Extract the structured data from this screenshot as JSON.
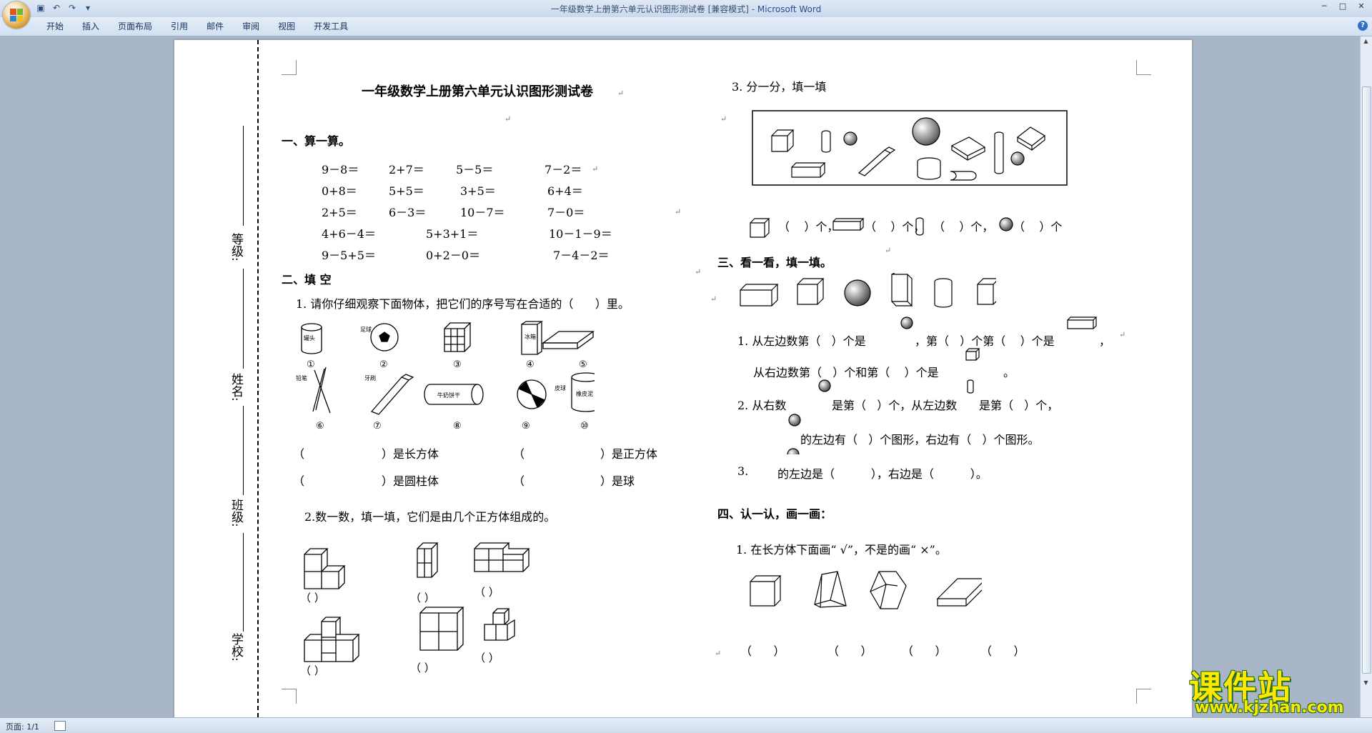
{
  "window": {
    "title_doc": "一年级数学上册第六单元认识图形测试卷 [兼容模式] - ",
    "title_app": "Microsoft Word",
    "min": "─",
    "max": "□",
    "close": "✕"
  },
  "qat": [
    "save-icon",
    "undo-icon",
    "redo-icon",
    "customize-icon"
  ],
  "ribbon_tabs": [
    "开始",
    "插入",
    "页面布局",
    "引用",
    "邮件",
    "审阅",
    "视图",
    "开发工具"
  ],
  "help": "?",
  "status": {
    "page": "页面: 1/1"
  },
  "binding": {
    "grade": "等级:",
    "name": "姓名:",
    "class": "班级:",
    "school": "学校:"
  },
  "doc": {
    "title": "一年级数学上册第六单元认识图形测试卷",
    "sec1": "一、算一算。",
    "calc_rows": [
      [
        "9－8＝",
        "2+7＝",
        "5－5＝",
        "7－2＝"
      ],
      [
        "0+8＝",
        "5+5＝",
        "3+5＝",
        "6+4＝"
      ],
      [
        "2+5＝",
        "6－3＝",
        "10－7＝",
        "7－0＝"
      ],
      [
        "4+6－4＝",
        "5+3+1＝",
        "10－1－9＝"
      ],
      [
        "9－5+5＝",
        "0+2－0＝",
        "7－4－2＝"
      ]
    ],
    "sec2": "二、填 空",
    "q2_1": "1. 请你仔细观察下面物体，把它们的序号写在合适的（      ）里。",
    "obj_labels": [
      "①",
      "②",
      "③",
      "④",
      "⑤",
      "⑥",
      "⑦",
      "⑧",
      "⑨",
      "⑩"
    ],
    "obj_text": [
      "罐头",
      "足球",
      "",
      "冰箱",
      "",
      "铅笔",
      "牙刷",
      "牛奶饼干",
      "皮球",
      "橡皮泥"
    ],
    "fill": [
      [
        "（",
        "）是长方体",
        "（",
        "）是正方体"
      ],
      [
        "（",
        "）是圆柱体",
        "（",
        "）是球"
      ]
    ],
    "q2_2": "2.数一数，填一填，它们是由几个正方体组成的。",
    "paren": "（      ）",
    "q3_head": "3. 分一分，填一填",
    "count_line": [
      "（    ）个，",
      "（    ）个，",
      "（    ）个，",
      "（    ）个"
    ],
    "sec3": "三、看一看，填一填。",
    "s3_l1": [
      "1. 从左边数第（   ）个是",
      "，第（   ）个第（    ）个是",
      "，"
    ],
    "s3_l2": [
      "从右边数第（   ）个和第（    ）个是",
      "。"
    ],
    "s3_l3": [
      "2. 从右数",
      "是第（   ）个，从左边数",
      "是第（   ）个，"
    ],
    "s3_l4": [
      "的左边有（   ）个图形，右边有（   ）个图形。"
    ],
    "s3_l5": [
      "3.",
      "的左边是（          ），右边是（          ）。"
    ],
    "sec4": "四、认一认，画一画：",
    "s4_q": "1. 在长方体下面画“ √”，不是的画“ ×”。",
    "s4_parens": [
      "（      ）",
      "（      ）",
      "（      ）",
      "（      ）"
    ]
  },
  "watermark": {
    "cn": "课件站",
    "url": "www.kjzhan.com"
  }
}
